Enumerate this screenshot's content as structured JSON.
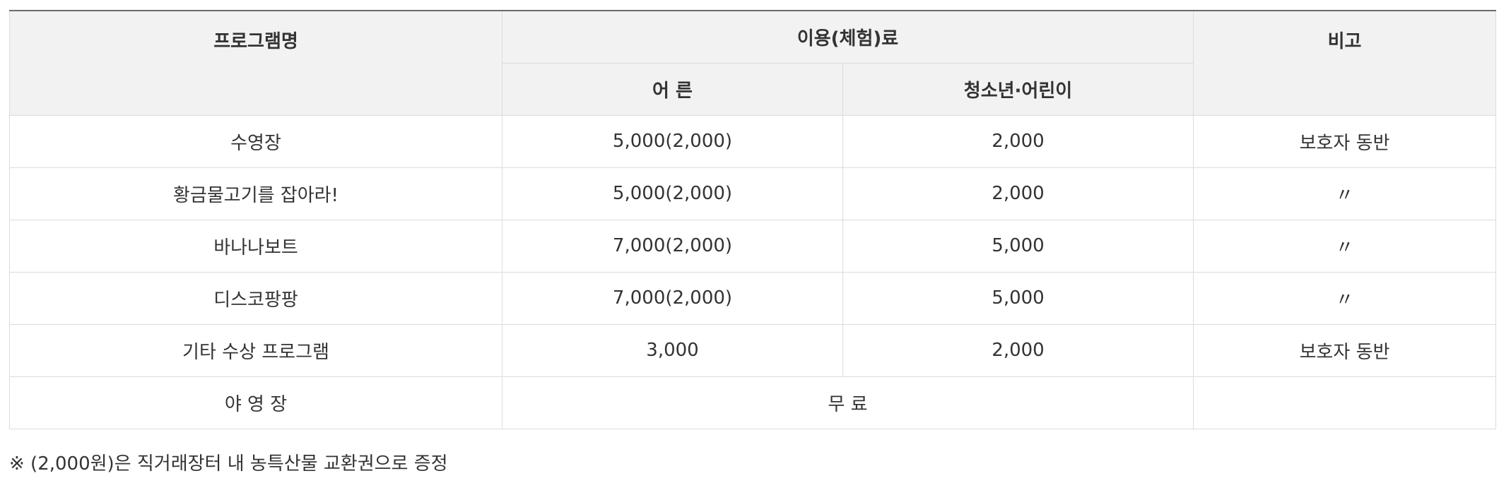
{
  "table": {
    "headers": {
      "program": "프로그램명",
      "fee": "이용(체험)료",
      "adult": "어 른",
      "youth": "청소년·어린이",
      "note": "비고"
    },
    "rows": [
      {
        "program": "수영장",
        "adult": "5,000(2,000)",
        "youth": "2,000",
        "note": "보호자 동반"
      },
      {
        "program": "황금물고기를 잡아라!",
        "adult": "5,000(2,000)",
        "youth": "2,000",
        "note": "〃"
      },
      {
        "program": "바나나보트",
        "adult": "7,000(2,000)",
        "youth": "5,000",
        "note": "〃"
      },
      {
        "program": "디스코팡팡",
        "adult": "7,000(2,000)",
        "youth": "5,000",
        "note": "〃"
      },
      {
        "program": "기타 수상 프로그램",
        "adult": "3,000",
        "youth": "2,000",
        "note": "보호자 동반"
      }
    ],
    "last_row": {
      "program": "야 영 장",
      "fee": "무 료",
      "note": ""
    }
  },
  "footnote": "※ (2,000원)은 직거래장터 내 농특산물 교환권으로 증정"
}
